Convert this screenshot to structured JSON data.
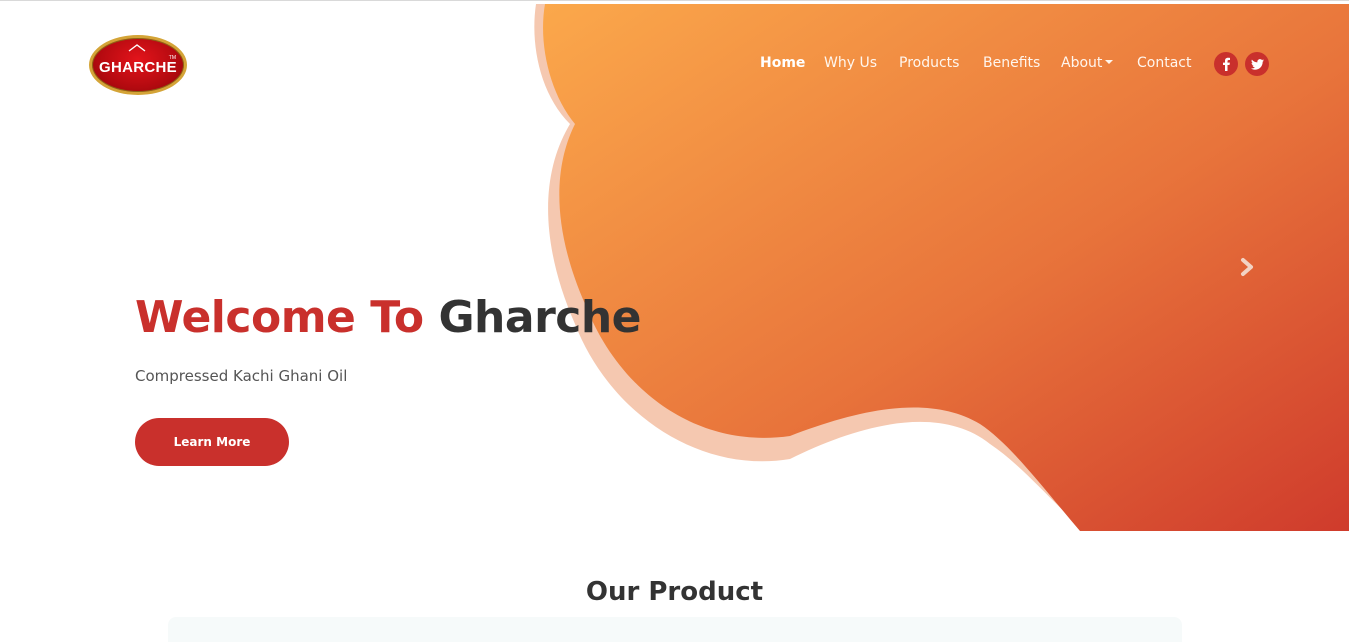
{
  "brand": {
    "logo_text": "GHARCHE",
    "logo_tm": "TM"
  },
  "nav": {
    "items": [
      {
        "label": "Home",
        "active": true
      },
      {
        "label": "Why Us",
        "active": false
      },
      {
        "label": "Products",
        "active": false
      },
      {
        "label": "Benefits",
        "active": false
      },
      {
        "label": "About",
        "active": false,
        "dropdown": true
      },
      {
        "label": "Contact",
        "active": false
      }
    ],
    "social": [
      {
        "icon": "facebook-icon"
      },
      {
        "icon": "twitter-icon"
      }
    ]
  },
  "hero": {
    "title_part1": "Welcome To",
    "title_part2": "Gharche",
    "subtitle": "Compressed Kachi Ghani Oil",
    "button_label": "Learn More",
    "carousel_next_icon": "chevron-right-icon"
  },
  "products": {
    "heading": "Our Product"
  },
  "colors": {
    "accent": "#c9302c",
    "gradient_start": "#fba84b",
    "gradient_end": "#cf3b2c",
    "blob_shadow": "#f5c8b0",
    "heading_dark": "#333333"
  }
}
